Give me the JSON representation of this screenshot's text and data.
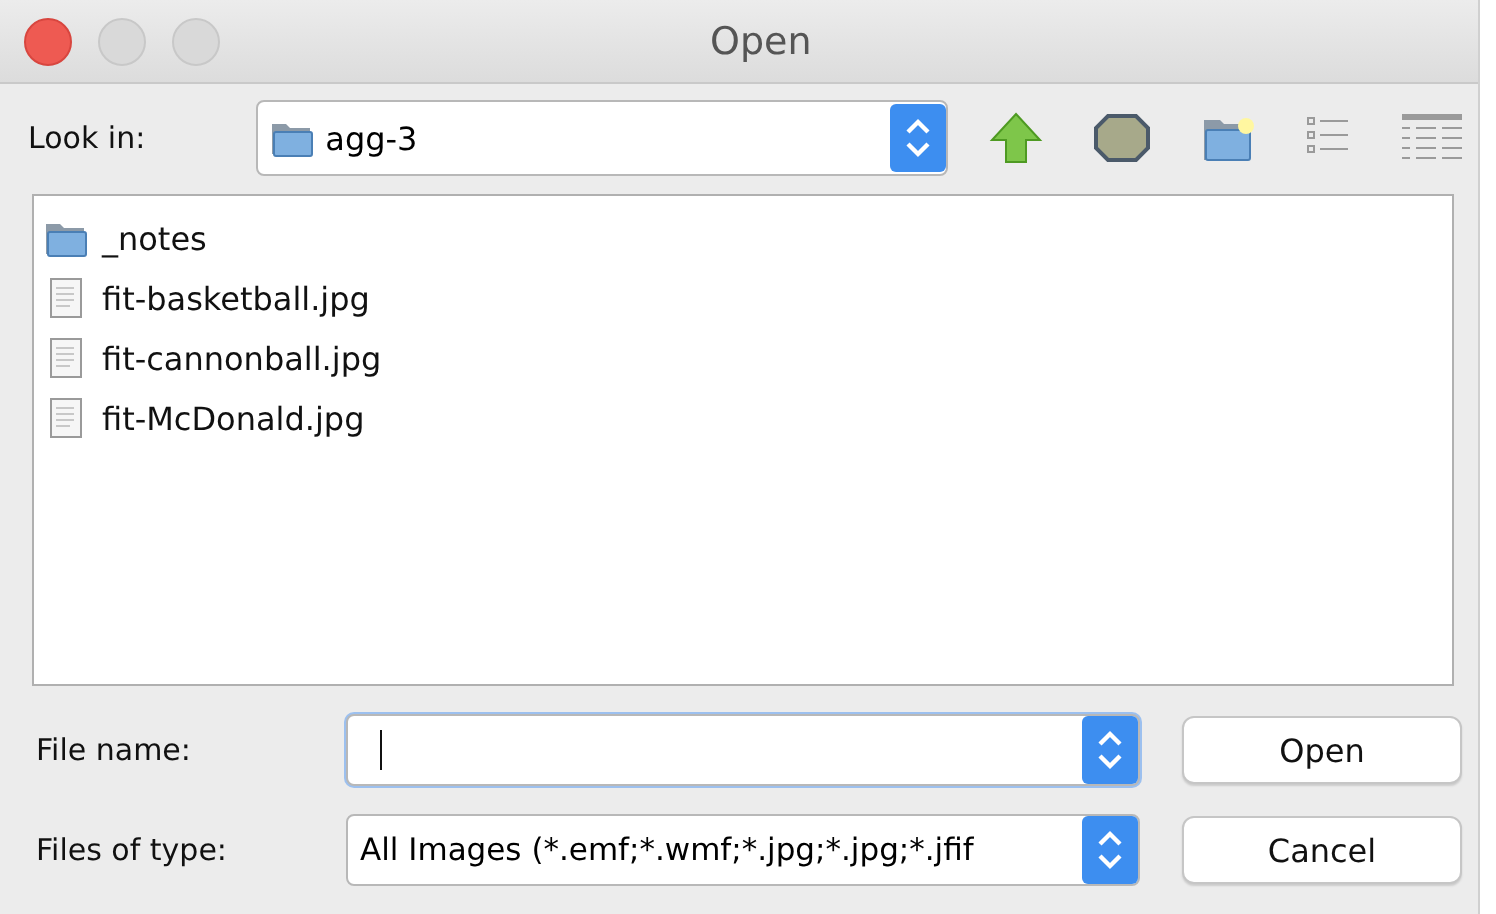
{
  "window": {
    "title": "Open"
  },
  "look_in": {
    "label": "Look in:",
    "value": "agg-3"
  },
  "toolbar": [
    {
      "kind": "up"
    },
    {
      "kind": "home"
    },
    {
      "kind": "new-folder"
    },
    {
      "kind": "list",
      "selected": false
    },
    {
      "kind": "details",
      "selected": false
    }
  ],
  "files": [
    {
      "name": "_notes",
      "kind": "folder"
    },
    {
      "name": "fit-basketball.jpg",
      "kind": "file"
    },
    {
      "name": "fit-cannonball.jpg",
      "kind": "file"
    },
    {
      "name": "fit-McDonald.jpg",
      "kind": "file"
    }
  ],
  "file_name": {
    "label": "File name:",
    "focused": true
  },
  "file_type": {
    "label": "Files of type:",
    "value": "All Images (*.emf;*.wmf;*.jpg;*.jpg;*.jfif"
  },
  "buttons": [
    "Open",
    "Cancel"
  ]
}
